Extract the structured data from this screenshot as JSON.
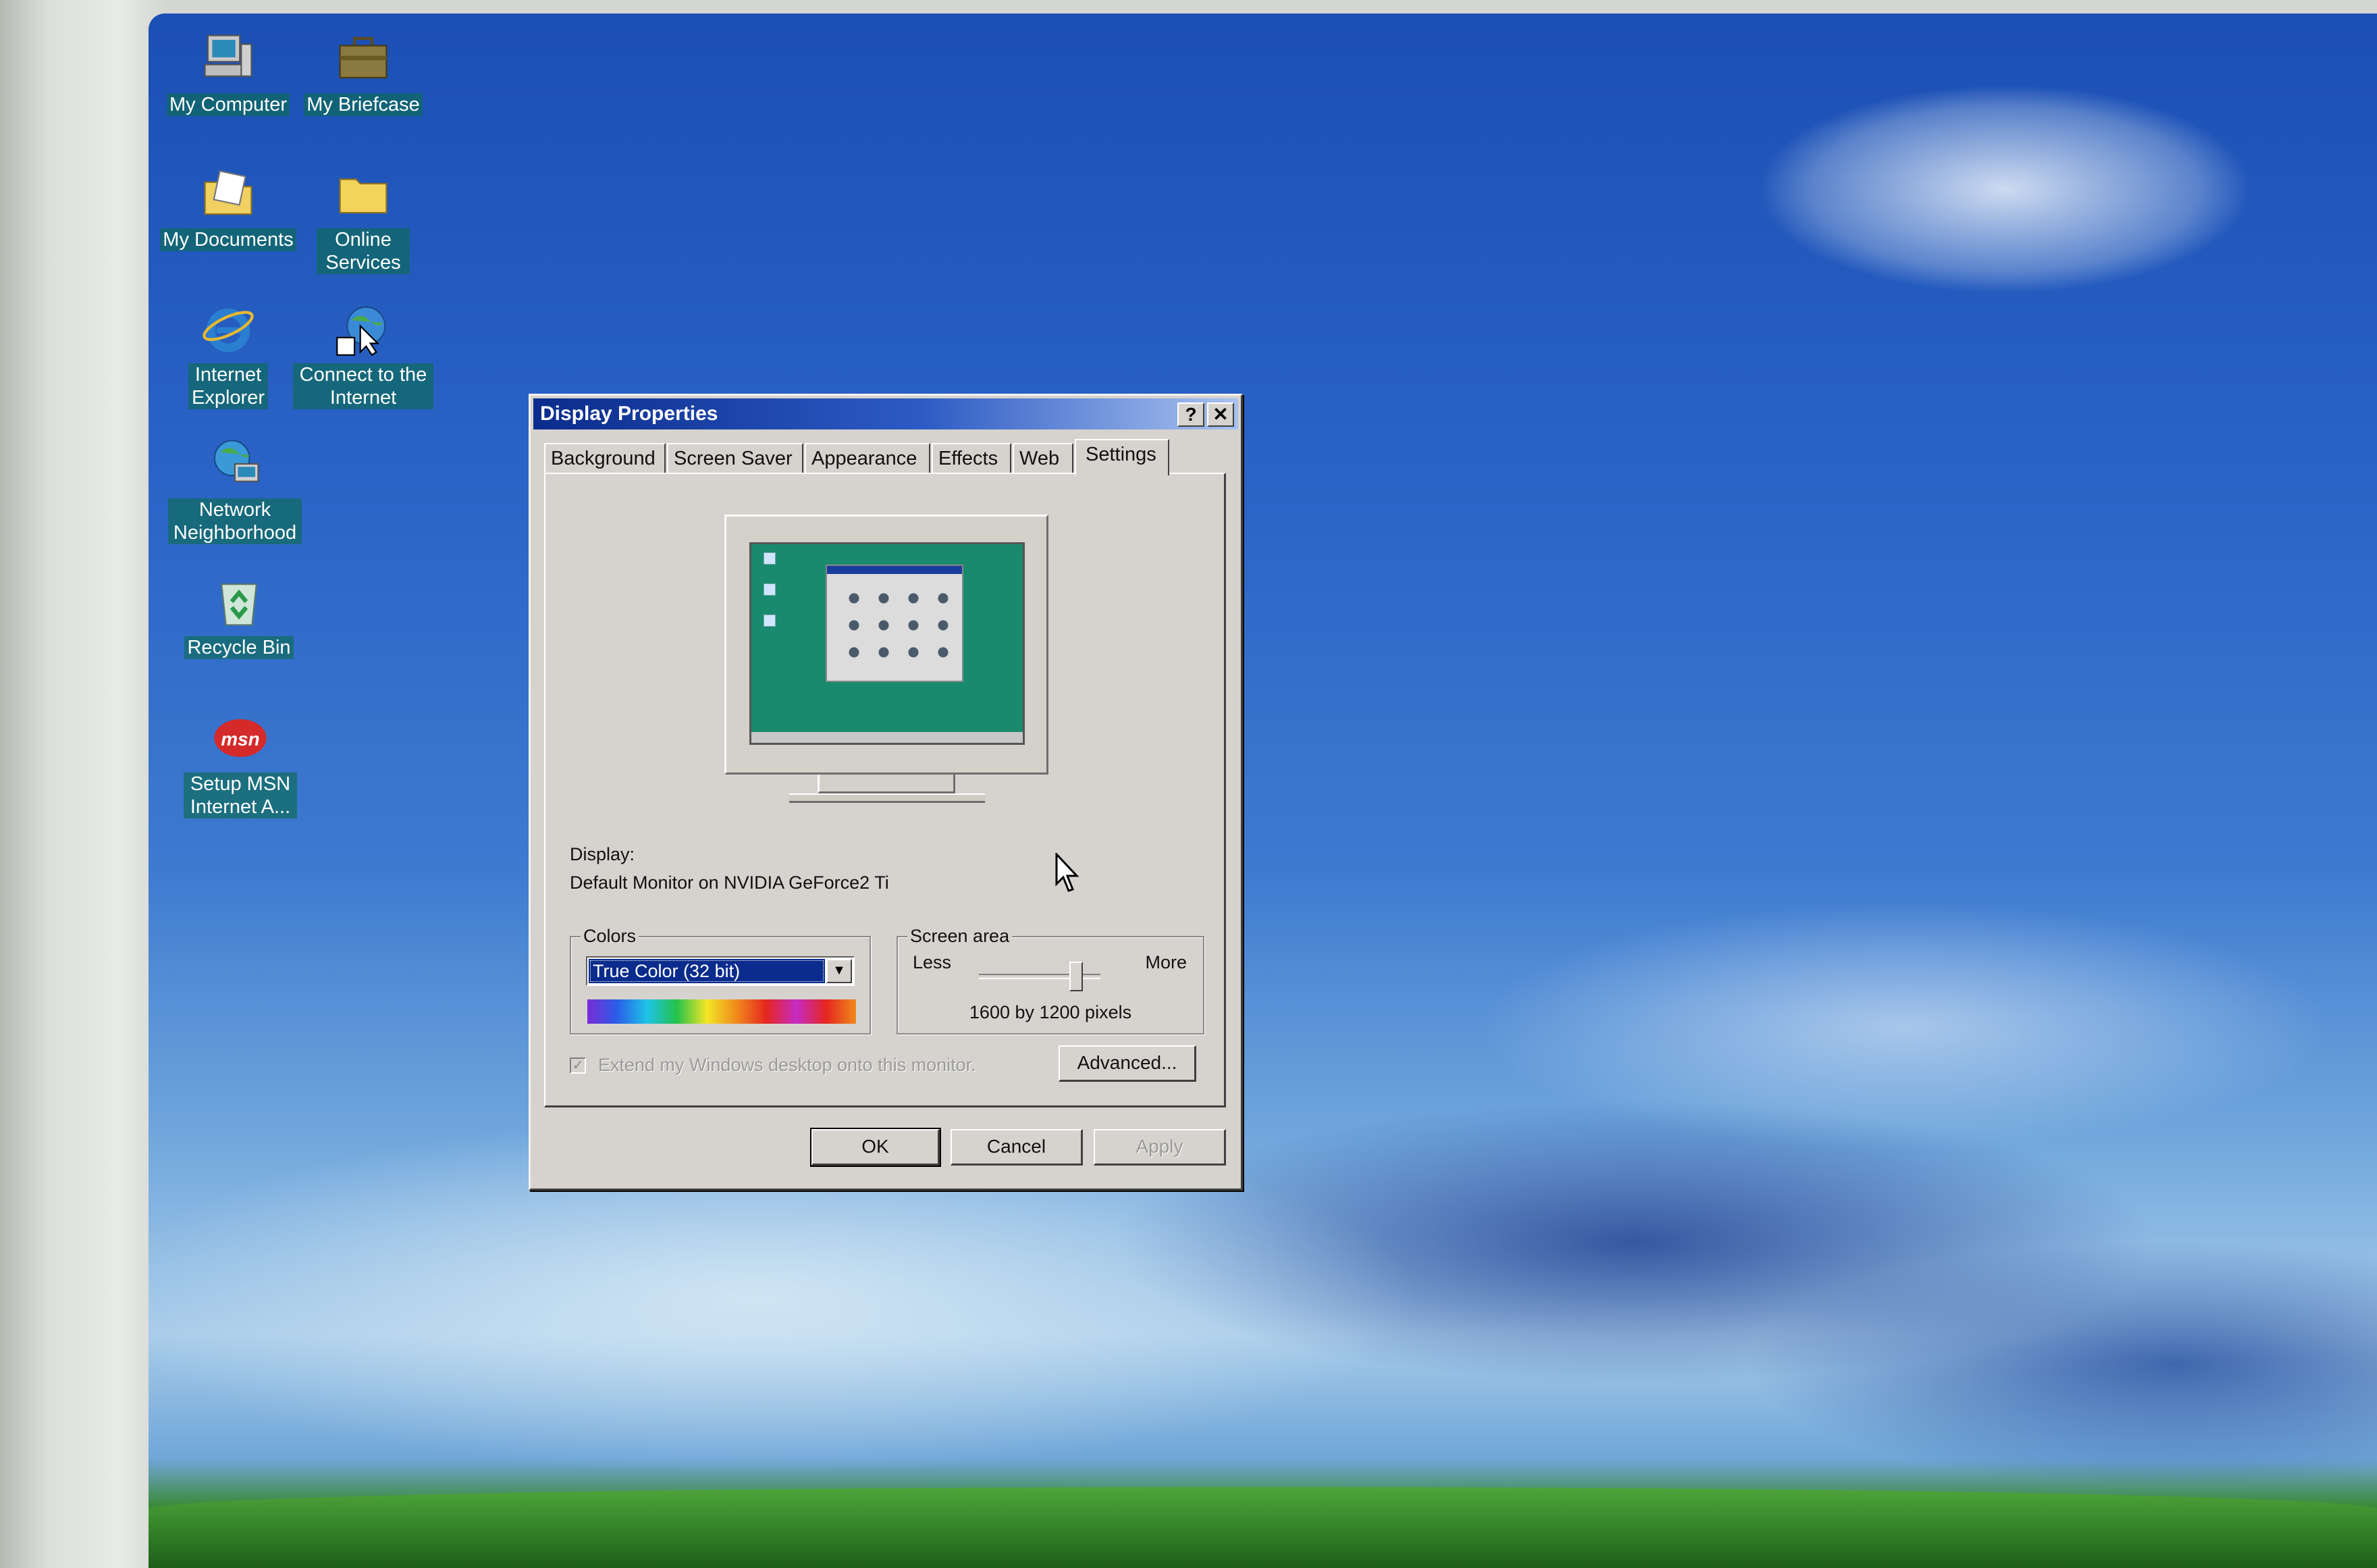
{
  "desktop": {
    "icons": [
      {
        "label": "My Computer",
        "icon": "my-computer-icon"
      },
      {
        "label": "My Briefcase",
        "icon": "briefcase-icon"
      },
      {
        "label": "My Documents",
        "icon": "my-documents-icon"
      },
      {
        "label_line1": "Online",
        "label_line2": "Services",
        "icon": "folder-icon"
      },
      {
        "label_line1": "Internet",
        "label_line2": "Explorer",
        "icon": "internet-explorer-icon"
      },
      {
        "label_line1": "Connect to the",
        "label_line2": "Internet",
        "icon": "connect-internet-icon"
      },
      {
        "label_line1": "Network",
        "label_line2": "Neighborhood",
        "icon": "network-icon"
      },
      {
        "label": "Recycle Bin",
        "icon": "recycle-bin-icon"
      },
      {
        "label_line1": "Setup MSN",
        "label_line2": "Internet A...",
        "icon": "msn-icon",
        "logo_text": "msn"
      }
    ]
  },
  "dialog": {
    "title": "Display Properties",
    "help_button": "?",
    "close_button": "✕",
    "tabs": [
      {
        "label": "Background",
        "active": false
      },
      {
        "label": "Screen Saver",
        "active": false
      },
      {
        "label": "Appearance",
        "active": false
      },
      {
        "label": "Effects",
        "active": false
      },
      {
        "label": "Web",
        "active": false
      },
      {
        "label": "Settings",
        "active": true
      }
    ],
    "settings": {
      "display_label": "Display:",
      "display_value": "Default Monitor on NVIDIA GeForce2 Ti",
      "colors": {
        "legend": "Colors",
        "selected": "True Color (32 bit)"
      },
      "screen_area": {
        "legend": "Screen area",
        "less": "Less",
        "more": "More",
        "value": "1600 by 1200 pixels",
        "slider_fraction": 0.8
      },
      "extend_checkbox": {
        "label": "Extend my Windows desktop onto this monitor.",
        "checked": true,
        "disabled": true
      },
      "advanced_button": "Advanced..."
    },
    "buttons": {
      "ok": "OK",
      "cancel": "Cancel",
      "apply": "Apply"
    }
  },
  "colors": {
    "title_bar": "#0b2c8c",
    "dialog_face": "#d6d3ce",
    "desktop_teal": "#1a8a6e"
  }
}
